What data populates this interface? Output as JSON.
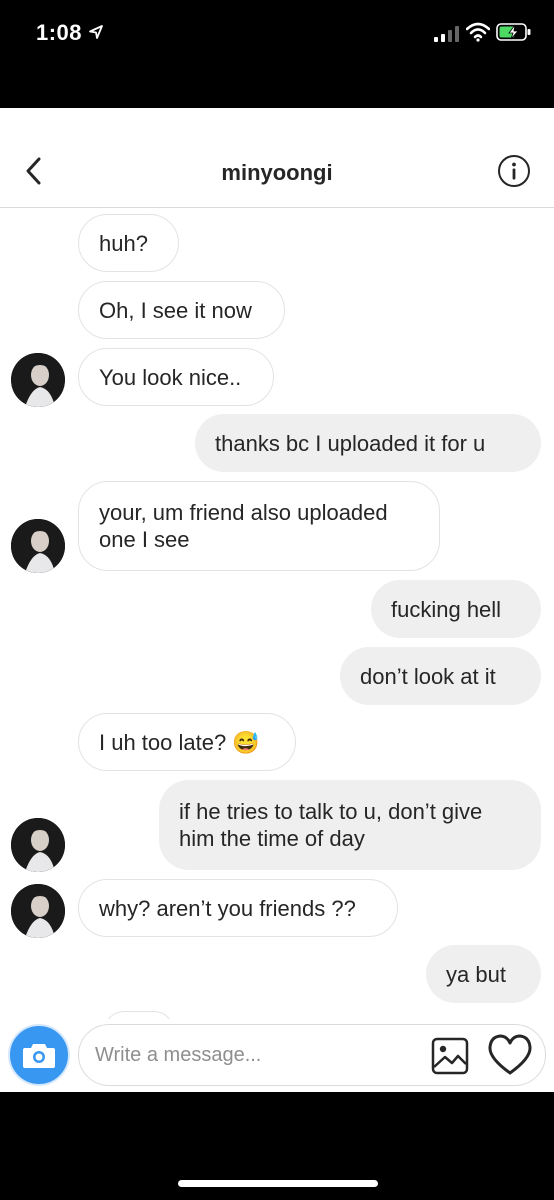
{
  "status_bar": {
    "time": "1:08"
  },
  "header": {
    "title": "minyoongi"
  },
  "messages": [
    {
      "text_lines": [
        "huh?"
      ]
    },
    {
      "text_lines": [
        "Oh, I see it now"
      ]
    },
    {
      "text_lines": [
        "You look nice.."
      ]
    },
    {
      "text_lines": [
        "thanks bc I uploaded it for u"
      ]
    },
    {
      "text_lines": [
        "your, um friend also uploaded",
        "one I see"
      ]
    },
    {
      "text_lines": [
        "fucking hell"
      ]
    },
    {
      "text_lines": [
        "don’t look at it"
      ]
    },
    {
      "text_lines": [
        "I uh too late? 😅"
      ]
    },
    {
      "text_lines": [
        "if he tries to talk to u, don’t give",
        "him the time of day"
      ]
    },
    {
      "text_lines": [
        "why? aren’t you friends ??"
      ]
    },
    {
      "text_lines": [
        "ya but"
      ]
    }
  ],
  "composer": {
    "placeholder": "Write a message..."
  },
  "colors": {
    "accent": "#3897f0",
    "outgoing_bubble": "#efefef",
    "incoming_border": "#e3e3e3",
    "battery_green": "#4cd964"
  },
  "icons": [
    "location-arrow-icon",
    "signal-icon",
    "wifi-icon",
    "battery-icon",
    "back-chevron-icon",
    "info-icon",
    "camera-icon",
    "gallery-icon",
    "heart-icon"
  ]
}
